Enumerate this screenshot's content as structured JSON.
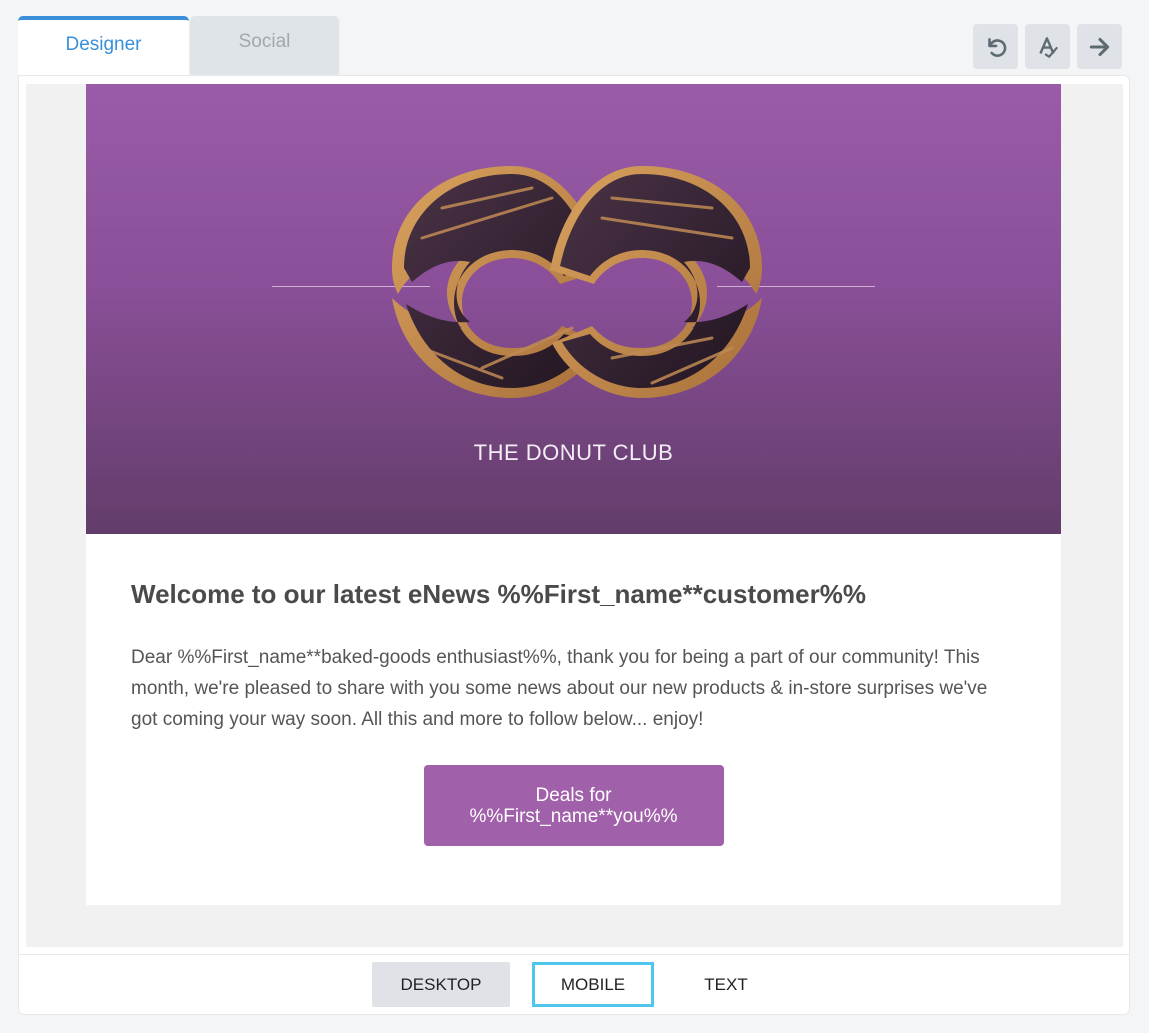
{
  "tabs": [
    {
      "label": "Designer",
      "active": true
    },
    {
      "label": "Social",
      "active": false
    }
  ],
  "toolbar": {
    "undo_icon": "undo-icon",
    "spellcheck_icon": "spellcheck-icon",
    "next_icon": "arrow-right-icon"
  },
  "email": {
    "hero": {
      "brand_name": "THE DONUT CLUB",
      "gradient_top": "#9a5ba8",
      "gradient_bottom": "#623d6a"
    },
    "headline": "Welcome to our latest eNews %%First_name**customer%%",
    "body": "Dear %%First_name**baked-goods enthusiast%%, thank you for being a part of our community! This month, we're pleased to share with you some news about our new products & in-store surprises we've got coming your way soon. All this and more to follow below... enjoy!",
    "cta_label": "Deals for %%First_name**you%%",
    "cta_color": "#a160aa"
  },
  "view_switcher": {
    "desktop": "DESKTOP",
    "mobile": "MOBILE",
    "text": "TEXT",
    "selected": "MOBILE"
  },
  "colors": {
    "accent": "#3a8fdb",
    "selected_outline": "#4fc6ee"
  }
}
